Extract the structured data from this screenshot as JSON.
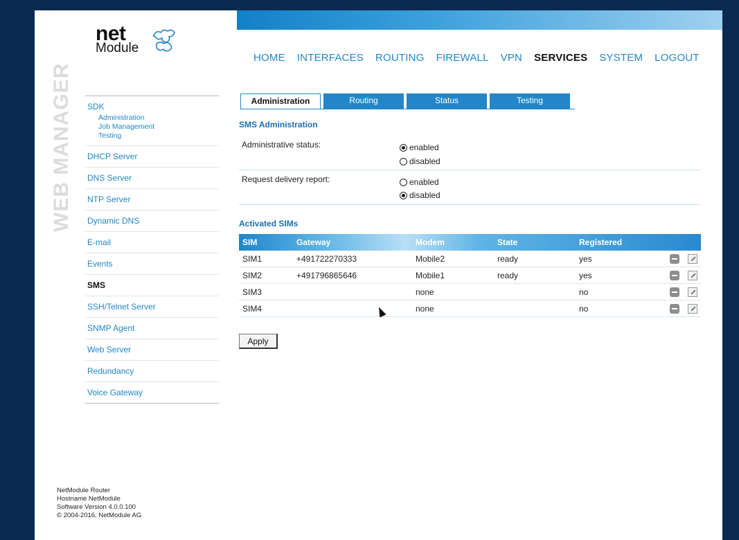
{
  "logo": {
    "net": "net",
    "module": "Module"
  },
  "watermark": "WEB MANAGER",
  "sidebar": {
    "sdk_label": "SDK",
    "sdk_sub": [
      "Administration",
      "Job Management",
      "Testing"
    ],
    "items": [
      "DHCP Server",
      "DNS Server",
      "NTP Server",
      "Dynamic DNS",
      "E-mail",
      "Events",
      "SMS",
      "SSH/Telnet Server",
      "SNMP Agent",
      "Web Server",
      "Redundancy",
      "Voice Gateway"
    ],
    "active": "SMS"
  },
  "footer": {
    "line1": "NetModule Router",
    "line2": "Hostname NetModule",
    "line3": "Software Version 4.0.0.100",
    "line4": "© 2004-2016, NetModule AG"
  },
  "menu": {
    "items": [
      "HOME",
      "INTERFACES",
      "ROUTING",
      "FIREWALL",
      "VPN",
      "SERVICES",
      "SYSTEM",
      "LOGOUT"
    ],
    "active": "SERVICES"
  },
  "tabs": [
    "Administration",
    "Routing",
    "Status",
    "Testing"
  ],
  "active_tab": "Administration",
  "sms_admin": {
    "title": "SMS Administration",
    "admin_status_label": "Administrative status:",
    "admin_status_options": [
      "enabled",
      "disabled"
    ],
    "admin_status_value": "enabled",
    "delivery_label": "Request delivery report:",
    "delivery_options": [
      "enabled",
      "disabled"
    ],
    "delivery_value": "disabled"
  },
  "activated_sims": {
    "title": "Activated SIMs",
    "columns": [
      "SIM",
      "Gateway",
      "Modem",
      "State",
      "Registered"
    ],
    "rows": [
      {
        "sim": "SIM1",
        "gateway": "+491722270333",
        "modem": "Mobile2",
        "state": "ready",
        "registered": "yes"
      },
      {
        "sim": "SIM2",
        "gateway": "+491796865646",
        "modem": "Mobile1",
        "state": "ready",
        "registered": "yes"
      },
      {
        "sim": "SIM3",
        "gateway": "",
        "modem": "none",
        "state": "",
        "registered": "no"
      },
      {
        "sim": "SIM4",
        "gateway": "",
        "modem": "none",
        "state": "",
        "registered": "no"
      }
    ]
  },
  "apply_label": "Apply",
  "colors": {
    "accent": "#2286c8",
    "header_bg": "#0b2a52",
    "section_title": "#1a6fb5"
  }
}
